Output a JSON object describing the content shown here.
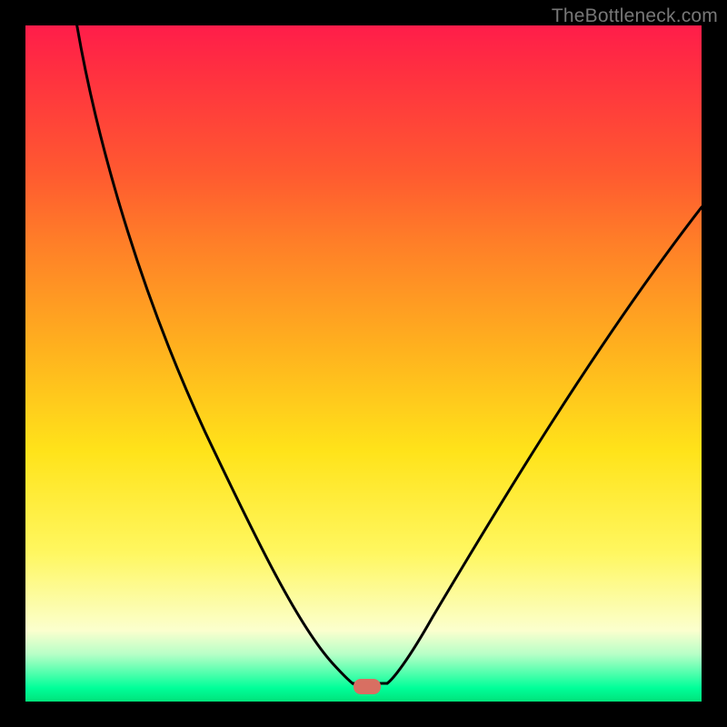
{
  "watermark": "TheBottleneck.com",
  "chart_data": {
    "type": "line",
    "title": "",
    "xlabel": "",
    "ylabel": "",
    "xlim": [
      0,
      100
    ],
    "ylim": [
      0,
      100
    ],
    "grid": false,
    "legend": false,
    "gradient_colors": {
      "top": "#ff1d4a",
      "mid_high": "#ffb21e",
      "mid_low": "#fff760",
      "bottom": "#00e27a"
    },
    "series": [
      {
        "name": "bottleneck-curve",
        "color": "#000000",
        "x": [
          0,
          5,
          10,
          15,
          20,
          25,
          30,
          35,
          40,
          45,
          47.5,
          50,
          52.5,
          55,
          60,
          65,
          70,
          75,
          80,
          85,
          90,
          95,
          100
        ],
        "y": [
          100,
          92,
          83,
          73.5,
          63.5,
          53,
          42,
          31,
          20,
          9,
          3,
          0,
          0,
          3,
          10,
          19,
          29,
          39,
          49,
          60,
          71,
          81,
          81
        ]
      }
    ],
    "marker": {
      "name": "optimal-point",
      "shape": "rounded-rect",
      "x": 50.5,
      "y": 0,
      "color": "#d86f62"
    }
  }
}
